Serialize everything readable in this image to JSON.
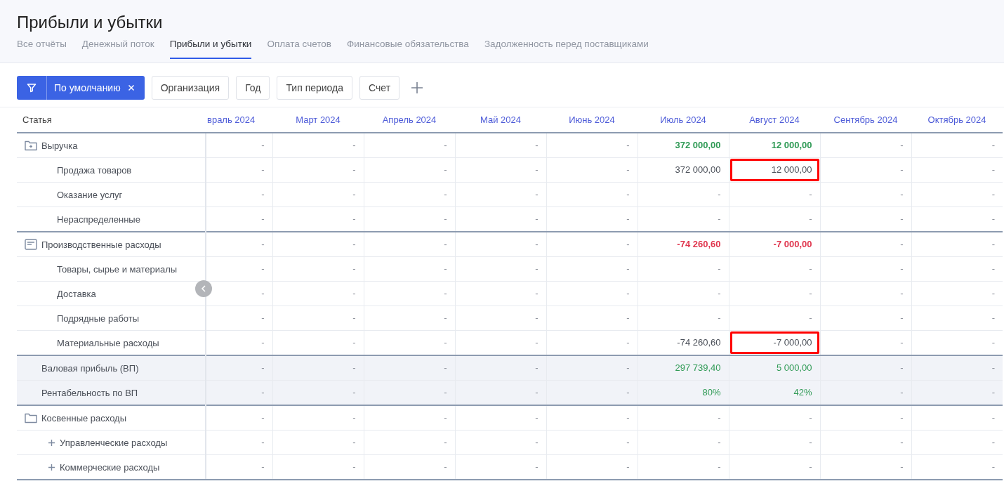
{
  "page_title": "Прибыли и убытки",
  "tabs": [
    {
      "label": "Все отчёты",
      "selected": false
    },
    {
      "label": "Денежный поток",
      "selected": false
    },
    {
      "label": "Прибыли и убытки",
      "selected": true
    },
    {
      "label": "Оплата счетов",
      "selected": false
    },
    {
      "label": "Финансовые обязательства",
      "selected": false
    },
    {
      "label": "Задолженность перед поставщиками",
      "selected": false
    }
  ],
  "filters": {
    "active_preset": "По умолчанию",
    "chips": [
      "Организация",
      "Год",
      "Тип периода",
      "Счет"
    ]
  },
  "table": {
    "first_column": "Статья",
    "columns": [
      "враль 2024",
      "Март 2024",
      "Апрель 2024",
      "Май 2024",
      "Июнь 2024",
      "Июль 2024",
      "Август 2024",
      "Сентябрь 2024",
      "Октябрь 2024"
    ],
    "rows": [
      {
        "kind": "group",
        "name": "Выручка",
        "color": "#2f9a55",
        "expandable": false,
        "cells": [
          {
            "text": "-",
            "empty": true,
            "highlighted": false
          },
          {
            "text": "-",
            "empty": true,
            "highlighted": false
          },
          {
            "text": "-",
            "empty": true,
            "highlighted": false
          },
          {
            "text": "-",
            "empty": true,
            "highlighted": false
          },
          {
            "text": "-",
            "empty": true,
            "highlighted": false
          },
          {
            "text": "372 000,00",
            "empty": false,
            "highlighted": false
          },
          {
            "text": "12 000,00",
            "empty": false,
            "highlighted": false
          },
          {
            "text": "-",
            "empty": true,
            "highlighted": false
          },
          {
            "text": "-",
            "empty": true,
            "highlighted": false
          }
        ]
      },
      {
        "kind": "item",
        "name": "Продажа товаров",
        "expandable": false,
        "cells": [
          {
            "text": "-",
            "empty": true,
            "highlighted": false
          },
          {
            "text": "-",
            "empty": true,
            "highlighted": false
          },
          {
            "text": "-",
            "empty": true,
            "highlighted": false
          },
          {
            "text": "-",
            "empty": true,
            "highlighted": false
          },
          {
            "text": "-",
            "empty": true,
            "highlighted": false
          },
          {
            "text": "372 000,00",
            "empty": false,
            "highlighted": false
          },
          {
            "text": "12 000,00",
            "empty": false,
            "highlighted": true
          },
          {
            "text": "-",
            "empty": true,
            "highlighted": false
          },
          {
            "text": "-",
            "empty": true,
            "highlighted": false
          }
        ]
      },
      {
        "kind": "item",
        "name": "Оказание услуг",
        "expandable": false,
        "cells": [
          {
            "text": "-",
            "empty": true,
            "highlighted": false
          },
          {
            "text": "-",
            "empty": true,
            "highlighted": false
          },
          {
            "text": "-",
            "empty": true,
            "highlighted": false
          },
          {
            "text": "-",
            "empty": true,
            "highlighted": false
          },
          {
            "text": "-",
            "empty": true,
            "highlighted": false
          },
          {
            "text": "-",
            "empty": true,
            "highlighted": false
          },
          {
            "text": "-",
            "empty": true,
            "highlighted": false
          },
          {
            "text": "-",
            "empty": true,
            "highlighted": false
          },
          {
            "text": "-",
            "empty": true,
            "highlighted": false
          }
        ]
      },
      {
        "kind": "item",
        "name": "Нераспределенные",
        "expandable": false,
        "cells": [
          {
            "text": "-",
            "empty": true,
            "highlighted": false
          },
          {
            "text": "-",
            "empty": true,
            "highlighted": false
          },
          {
            "text": "-",
            "empty": true,
            "highlighted": false
          },
          {
            "text": "-",
            "empty": true,
            "highlighted": false
          },
          {
            "text": "-",
            "empty": true,
            "highlighted": false
          },
          {
            "text": "-",
            "empty": true,
            "highlighted": false
          },
          {
            "text": "-",
            "empty": true,
            "highlighted": false
          },
          {
            "text": "-",
            "empty": true,
            "highlighted": false
          },
          {
            "text": "-",
            "empty": true,
            "highlighted": false
          }
        ]
      },
      {
        "kind": "group",
        "name": "Производственные расходы",
        "color": "#e0364e",
        "expandable": false,
        "cells": [
          {
            "text": "-",
            "empty": true,
            "highlighted": false
          },
          {
            "text": "-",
            "empty": true,
            "highlighted": false
          },
          {
            "text": "-",
            "empty": true,
            "highlighted": false
          },
          {
            "text": "-",
            "empty": true,
            "highlighted": false
          },
          {
            "text": "-",
            "empty": true,
            "highlighted": false
          },
          {
            "text": "-74 260,60",
            "empty": false,
            "highlighted": false
          },
          {
            "text": "-7 000,00",
            "empty": false,
            "highlighted": false
          },
          {
            "text": "-",
            "empty": true,
            "highlighted": false
          },
          {
            "text": "-",
            "empty": true,
            "highlighted": false
          }
        ]
      },
      {
        "kind": "item",
        "name": "Товары, сырье и материалы",
        "expandable": false,
        "cells": [
          {
            "text": "-",
            "empty": true,
            "highlighted": false
          },
          {
            "text": "-",
            "empty": true,
            "highlighted": false
          },
          {
            "text": "-",
            "empty": true,
            "highlighted": false
          },
          {
            "text": "-",
            "empty": true,
            "highlighted": false
          },
          {
            "text": "-",
            "empty": true,
            "highlighted": false
          },
          {
            "text": "-",
            "empty": true,
            "highlighted": false
          },
          {
            "text": "-",
            "empty": true,
            "highlighted": false
          },
          {
            "text": "-",
            "empty": true,
            "highlighted": false
          },
          {
            "text": "-",
            "empty": true,
            "highlighted": false
          }
        ]
      },
      {
        "kind": "item",
        "name": "Доставка",
        "expandable": false,
        "cells": [
          {
            "text": "-",
            "empty": true,
            "highlighted": false
          },
          {
            "text": "-",
            "empty": true,
            "highlighted": false
          },
          {
            "text": "-",
            "empty": true,
            "highlighted": false
          },
          {
            "text": "-",
            "empty": true,
            "highlighted": false
          },
          {
            "text": "-",
            "empty": true,
            "highlighted": false
          },
          {
            "text": "-",
            "empty": true,
            "highlighted": false
          },
          {
            "text": "-",
            "empty": true,
            "highlighted": false
          },
          {
            "text": "-",
            "empty": true,
            "highlighted": false
          },
          {
            "text": "-",
            "empty": true,
            "highlighted": false
          }
        ]
      },
      {
        "kind": "item",
        "name": "Подрядные работы",
        "expandable": false,
        "cells": [
          {
            "text": "-",
            "empty": true,
            "highlighted": false
          },
          {
            "text": "-",
            "empty": true,
            "highlighted": false
          },
          {
            "text": "-",
            "empty": true,
            "highlighted": false
          },
          {
            "text": "-",
            "empty": true,
            "highlighted": false
          },
          {
            "text": "-",
            "empty": true,
            "highlighted": false
          },
          {
            "text": "-",
            "empty": true,
            "highlighted": false
          },
          {
            "text": "-",
            "empty": true,
            "highlighted": false
          },
          {
            "text": "-",
            "empty": true,
            "highlighted": false
          },
          {
            "text": "-",
            "empty": true,
            "highlighted": false
          }
        ]
      },
      {
        "kind": "item",
        "name": "Материальные расходы",
        "expandable": false,
        "cells": [
          {
            "text": "-",
            "empty": true,
            "highlighted": false
          },
          {
            "text": "-",
            "empty": true,
            "highlighted": false
          },
          {
            "text": "-",
            "empty": true,
            "highlighted": false
          },
          {
            "text": "-",
            "empty": true,
            "highlighted": false
          },
          {
            "text": "-",
            "empty": true,
            "highlighted": false
          },
          {
            "text": "-74 260,60",
            "empty": false,
            "highlighted": false
          },
          {
            "text": "-7 000,00",
            "empty": false,
            "highlighted": true
          },
          {
            "text": "-",
            "empty": true,
            "highlighted": false
          },
          {
            "text": "-",
            "empty": true,
            "highlighted": false
          }
        ]
      },
      {
        "kind": "summary",
        "name": "Валовая прибыль (ВП)",
        "color": "#2f9a55",
        "expandable": false,
        "cells": [
          {
            "text": "-",
            "empty": true,
            "highlighted": false
          },
          {
            "text": "-",
            "empty": true,
            "highlighted": false
          },
          {
            "text": "-",
            "empty": true,
            "highlighted": false
          },
          {
            "text": "-",
            "empty": true,
            "highlighted": false
          },
          {
            "text": "-",
            "empty": true,
            "highlighted": false
          },
          {
            "text": "297 739,40",
            "empty": false,
            "highlighted": false
          },
          {
            "text": "5 000,00",
            "empty": false,
            "highlighted": false
          },
          {
            "text": "-",
            "empty": true,
            "highlighted": false
          },
          {
            "text": "-",
            "empty": true,
            "highlighted": false
          }
        ]
      },
      {
        "kind": "summary",
        "name": "Рентабельность по ВП",
        "color": "#2f9a55",
        "expandable": false,
        "cells": [
          {
            "text": "-",
            "empty": true,
            "highlighted": false
          },
          {
            "text": "-",
            "empty": true,
            "highlighted": false
          },
          {
            "text": "-",
            "empty": true,
            "highlighted": false
          },
          {
            "text": "-",
            "empty": true,
            "highlighted": false
          },
          {
            "text": "-",
            "empty": true,
            "highlighted": false
          },
          {
            "text": "80%",
            "empty": false,
            "highlighted": false
          },
          {
            "text": "42%",
            "empty": false,
            "highlighted": false
          },
          {
            "text": "-",
            "empty": true,
            "highlighted": false
          },
          {
            "text": "-",
            "empty": true,
            "highlighted": false
          }
        ]
      },
      {
        "kind": "group",
        "name": "Косвенные расходы",
        "expandable": false,
        "cells": [
          {
            "text": "-",
            "empty": true,
            "highlighted": false
          },
          {
            "text": "-",
            "empty": true,
            "highlighted": false
          },
          {
            "text": "-",
            "empty": true,
            "highlighted": false
          },
          {
            "text": "-",
            "empty": true,
            "highlighted": false
          },
          {
            "text": "-",
            "empty": true,
            "highlighted": false
          },
          {
            "text": "-",
            "empty": true,
            "highlighted": false
          },
          {
            "text": "-",
            "empty": true,
            "highlighted": false
          },
          {
            "text": "-",
            "empty": true,
            "highlighted": false
          },
          {
            "text": "-",
            "empty": true,
            "highlighted": false
          }
        ]
      },
      {
        "kind": "item",
        "name": "Управленческие расходы",
        "expandable": true,
        "cells": [
          {
            "text": "-",
            "empty": true,
            "highlighted": false
          },
          {
            "text": "-",
            "empty": true,
            "highlighted": false
          },
          {
            "text": "-",
            "empty": true,
            "highlighted": false
          },
          {
            "text": "-",
            "empty": true,
            "highlighted": false
          },
          {
            "text": "-",
            "empty": true,
            "highlighted": false
          },
          {
            "text": "-",
            "empty": true,
            "highlighted": false
          },
          {
            "text": "-",
            "empty": true,
            "highlighted": false
          },
          {
            "text": "-",
            "empty": true,
            "highlighted": false
          },
          {
            "text": "-",
            "empty": true,
            "highlighted": false
          }
        ]
      },
      {
        "kind": "item",
        "name": "Коммерческие расходы",
        "expandable": true,
        "cells": [
          {
            "text": "-",
            "empty": true,
            "highlighted": false
          },
          {
            "text": "-",
            "empty": true,
            "highlighted": false
          },
          {
            "text": "-",
            "empty": true,
            "highlighted": false
          },
          {
            "text": "-",
            "empty": true,
            "highlighted": false
          },
          {
            "text": "-",
            "empty": true,
            "highlighted": false
          },
          {
            "text": "-",
            "empty": true,
            "highlighted": false
          },
          {
            "text": "-",
            "empty": true,
            "highlighted": false
          },
          {
            "text": "-",
            "empty": true,
            "highlighted": false
          },
          {
            "text": "-",
            "empty": true,
            "highlighted": false
          }
        ]
      }
    ]
  }
}
